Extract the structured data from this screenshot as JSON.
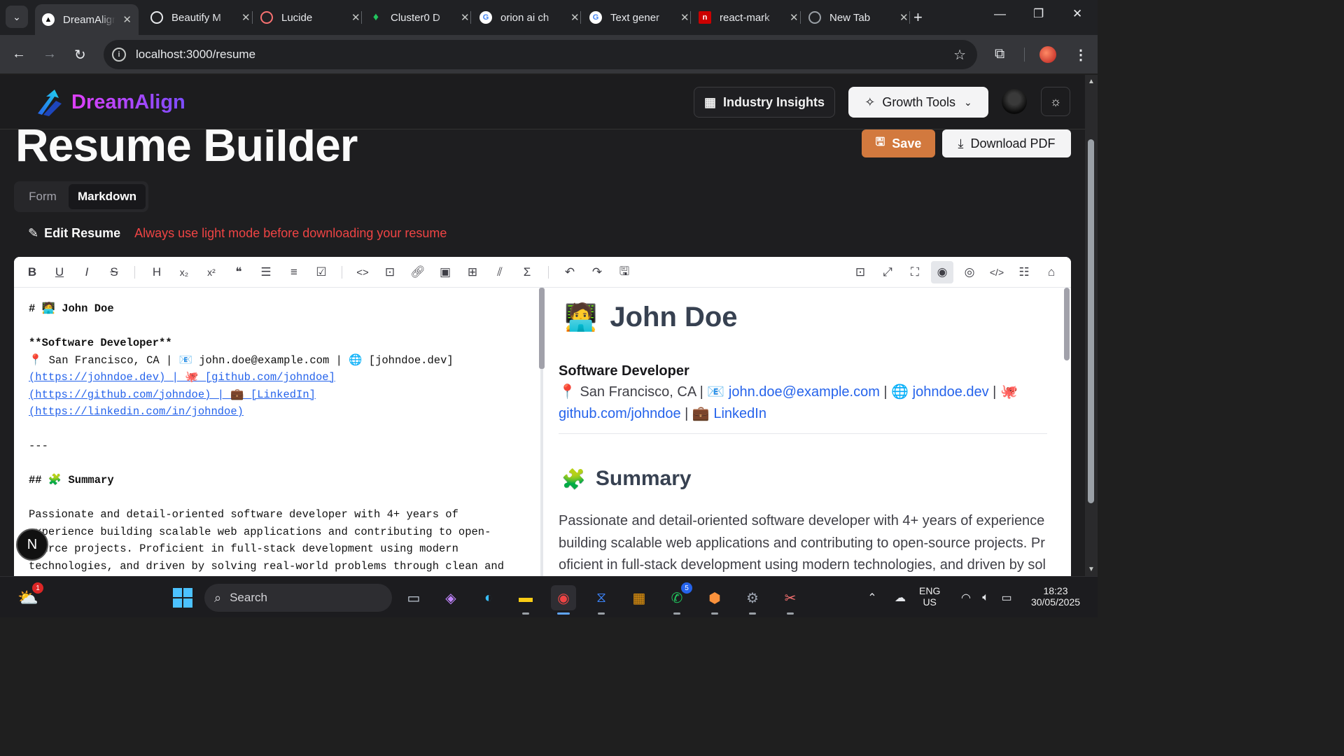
{
  "browser": {
    "tabs": [
      {
        "title": "DreamAlign",
        "active": true
      },
      {
        "title": "Beautify M",
        "active": false
      },
      {
        "title": "Lucide",
        "active": false
      },
      {
        "title": "Cluster0 D",
        "active": false
      },
      {
        "title": "orion ai ch",
        "active": false
      },
      {
        "title": "Text gener",
        "active": false
      },
      {
        "title": "react-mark",
        "active": false
      },
      {
        "title": "New Tab",
        "active": false
      }
    ],
    "url": "localhost:3000/resume"
  },
  "app": {
    "brand": "DreamAlign",
    "nav": {
      "insights": "Industry Insights",
      "growth": "Growth Tools"
    },
    "page_title": "Resume Builder",
    "save_label": "Save",
    "download_label": "Download PDF",
    "mode_tabs": {
      "form": "Form",
      "markdown": "Markdown",
      "selected": "Markdown"
    },
    "edit_label": "Edit Resume",
    "warning": "Always use light mode before downloading your resume",
    "badge_letter": "N"
  },
  "editor": {
    "source_lines": [
      "# 🧑‍💻 John Doe",
      "",
      "**Software Developer**",
      "📍 San Francisco, CA | 📧 john.doe@example.com | 🌐 [johndoe.dev]",
      "(https://johndoe.dev) | 🐙 [github.com/johndoe]",
      "(https://github.com/johndoe) | 💼 [LinkedIn]",
      "(https://linkedin.com/in/johndoe)",
      "",
      "---",
      "",
      "## 🧩 Summary",
      "",
      "Passionate and detail-oriented software developer with 4+ years of",
      "experience building scalable web applications and contributing to open-",
      "source projects. Proficient in full-stack development using modern",
      "technologies, and driven by solving real-world problems through clean and"
    ],
    "preview": {
      "name": "John Doe",
      "name_emoji": "🧑‍💻",
      "role": "Software Developer",
      "location": "San Francisco, CA",
      "email": "john.doe@example.com",
      "website": "johndoe.dev",
      "github": "github.com/johndoe",
      "linkedin": "LinkedIn",
      "summary_heading": "Summary",
      "summary_emoji": "🧩",
      "summary_text": "Passionate and detail-oriented software developer with 4+ years of experience building scalable web applications and contributing to open-source projects. Proficient in full-stack development using modern technologies, and driven by solvin"
    }
  },
  "taskbar": {
    "search": "Search",
    "lang": "ENG",
    "region": "US",
    "time": "18:23",
    "date": "30/05/2025",
    "weather_badge": "1",
    "whatsapp_badge": "5"
  },
  "colors": {
    "accent": "#d2793e",
    "warning": "#ef4444",
    "link": "#2563eb"
  }
}
